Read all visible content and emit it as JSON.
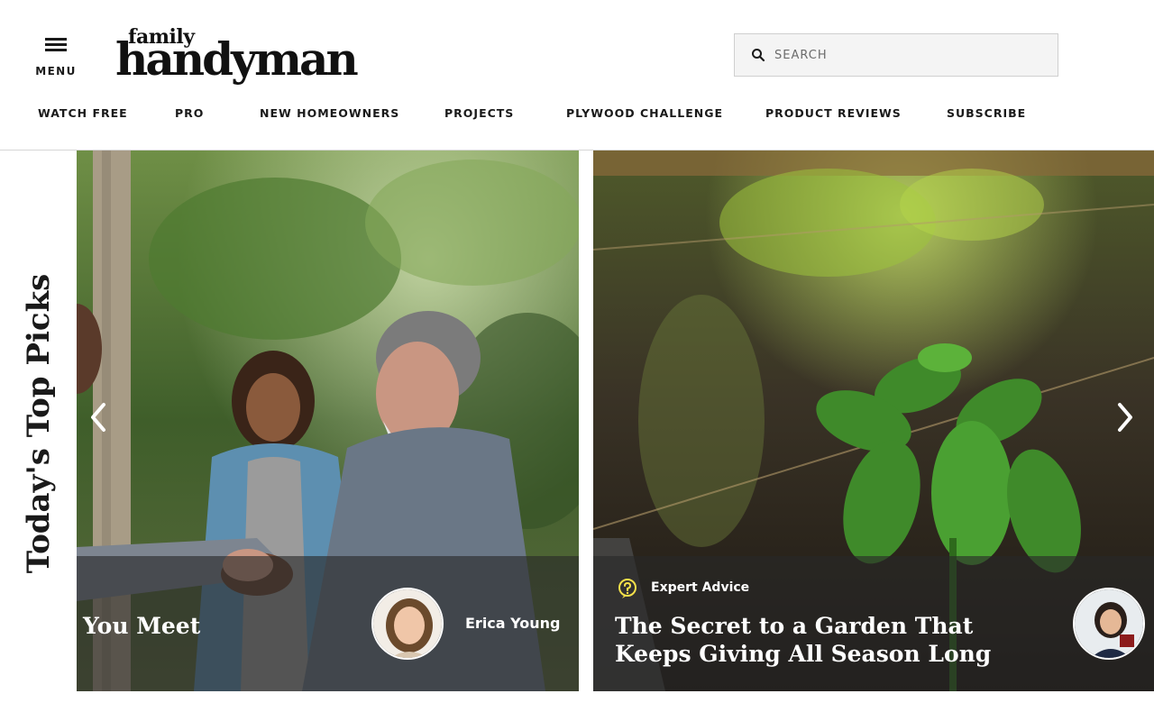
{
  "header": {
    "menu_label": "MENU",
    "logo_top": "family",
    "logo_bottom": "handyman",
    "search_placeholder": "SEARCH"
  },
  "nav": [
    {
      "label": "WATCH FREE"
    },
    {
      "label": "PRO"
    },
    {
      "label": "NEW HOMEOWNERS"
    },
    {
      "label": "PROJECTS"
    },
    {
      "label": "PLYWOOD CHALLENGE"
    },
    {
      "label": "PRODUCT REVIEWS"
    },
    {
      "label": "SUBSCRIBE"
    }
  ],
  "top_picks": {
    "heading": "Today's Top Picks",
    "cards": [
      {
        "title_partial": "You Meet",
        "author": "Erica Young"
      },
      {
        "category": "Expert Advice",
        "title_line1": "The Secret to a Garden That",
        "title_line2": "Keeps Giving All Season Long"
      }
    ]
  },
  "colors": {
    "text": "#1a1a1a",
    "search_bg": "#f4f4f4",
    "overlay": "rgba(40,40,40,0.62)",
    "accent_icon": "#f5e04a"
  }
}
